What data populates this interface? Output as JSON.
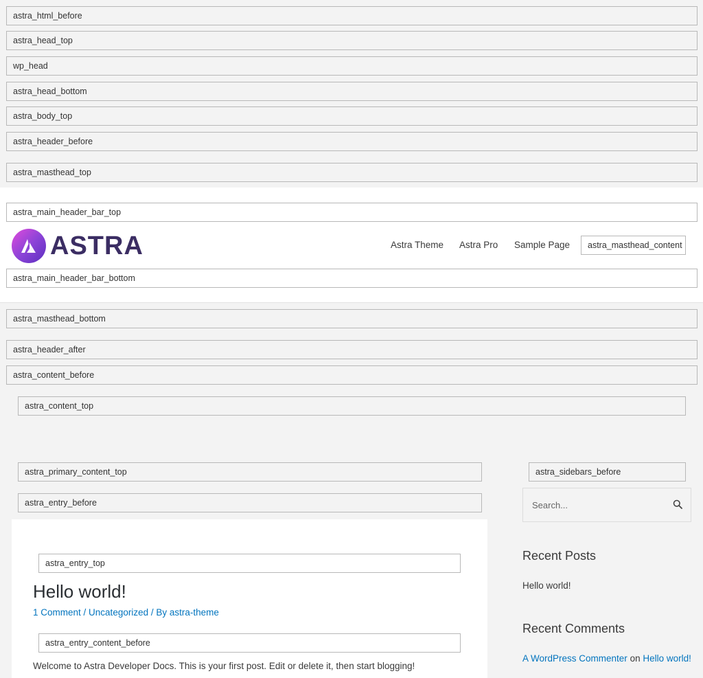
{
  "hooks": {
    "html_before": "astra_html_before",
    "head_top": "astra_head_top",
    "wp_head": "wp_head",
    "head_bottom": "astra_head_bottom",
    "body_top": "astra_body_top",
    "header_before": "astra_header_before",
    "masthead_top": "astra_masthead_top",
    "main_header_bar_top": "astra_main_header_bar_top",
    "masthead_content": "astra_masthead_content",
    "main_header_bar_bottom": "astra_main_header_bar_bottom",
    "masthead_bottom": "astra_masthead_bottom",
    "header_after": "astra_header_after",
    "content_before": "astra_content_before",
    "content_top": "astra_content_top",
    "primary_content_top": "astra_primary_content_top",
    "sidebars_before": "astra_sidebars_before",
    "entry_before": "astra_entry_before",
    "entry_top": "astra_entry_top",
    "entry_content_before": "astra_entry_content_before"
  },
  "logo": {
    "text": "ASTRA"
  },
  "nav": {
    "items": [
      "Astra Theme",
      "Astra Pro",
      "Sample Page"
    ]
  },
  "post": {
    "title": "Hello world!",
    "comments_link": "1 Comment",
    "sep1": " / ",
    "category": "Uncategorized",
    "sep2": " / By ",
    "author": "astra-theme",
    "excerpt": "Welcome to Astra Developer Docs. This is your first post. Edit or delete it, then start blogging!"
  },
  "sidebar": {
    "search_placeholder": "Search...",
    "recent_posts_title": "Recent Posts",
    "recent_posts": [
      "Hello world!"
    ],
    "recent_comments_title": "Recent Comments",
    "comment_author": "A WordPress Commenter",
    "comment_on": " on ",
    "comment_post": "Hello world!"
  },
  "colors": {
    "link": "#0274be",
    "page_bg": "#f3f3f3",
    "logo_gradient_start": "#e14bdb",
    "logo_gradient_end": "#5b2fbf",
    "logo_text": "#3b2d63"
  }
}
